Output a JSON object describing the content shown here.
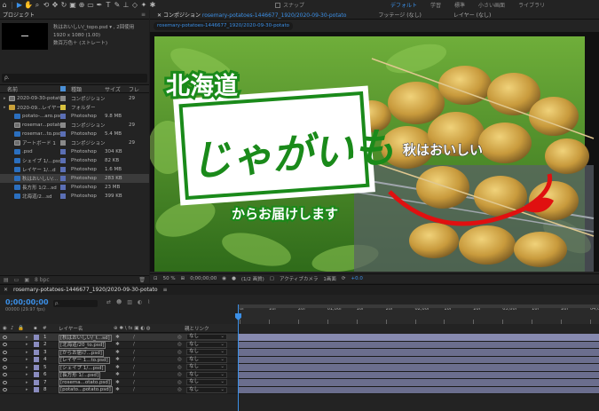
{
  "toolbar": {
    "snap_label": "スナップ",
    "workspaces": [
      "デフォルト",
      "学習",
      "標準",
      "小さい画面",
      "ライブラリ"
    ],
    "tools": [
      "select-icon",
      "hand-icon",
      "zoom-icon",
      "orbit-icon",
      "move-icon",
      "rotate-icon",
      "camera-icon",
      "anchor-icon",
      "rectangle-icon",
      "pen-icon",
      "type-icon",
      "brush-icon",
      "stamp-icon",
      "eraser-icon",
      "roto-icon",
      "puppet-icon"
    ]
  },
  "project": {
    "title": "プロジェクト",
    "selected_name": "秋はおいしい/_topo.psd ▾ , 2回使用",
    "selected_dims": "1920 x 1080 (1.00)",
    "selected_color": "数百万色＋ (ストレート)",
    "search_icon": "ρ.",
    "columns": {
      "name": "名前",
      "type": "種類",
      "size": "サイズ",
      "fr": "フレ"
    },
    "items": [
      {
        "name": "2020-09-30-potato",
        "type": "コンポジション",
        "size": "",
        "fr": "29",
        "icon": "comp",
        "indent": 0,
        "label_color": "#8a8a8a"
      },
      {
        "name": "2020-09...レイヤー",
        "type": "フォルダー",
        "size": "",
        "fr": "",
        "icon": "folder",
        "indent": 0,
        "label_color": "#d8c23e"
      },
      {
        "name": "potato-...aro.psd",
        "type": "Photoshop",
        "size": "9.8 MB",
        "fr": "",
        "icon": "psd",
        "indent": 1,
        "label_color": "#5b6fb5"
      },
      {
        "name": "rosemar...potato",
        "type": "コンポジション",
        "size": "",
        "fr": "29",
        "icon": "comp",
        "indent": 1,
        "label_color": "#8a8a8a"
      },
      {
        "name": "rosemar...to.psd",
        "type": "Photoshop",
        "size": "5.4 MB",
        "fr": "",
        "icon": "psd",
        "indent": 1,
        "label_color": "#5b6fb5"
      },
      {
        "name": "アートボード 1",
        "type": "コンポジション",
        "size": "",
        "fr": "29",
        "icon": "comp",
        "indent": 1,
        "label_color": "#8a8a8a"
      },
      {
        "name": ".psd",
        "type": "Photoshop",
        "size": "304 KB",
        "fr": "",
        "icon": "psd",
        "indent": 1,
        "label_color": "#5b6fb5"
      },
      {
        "name": "シェイプ 1/...psd",
        "type": "Photoshop",
        "size": "82 KB",
        "fr": "",
        "icon": "psd",
        "indent": 1,
        "label_color": "#5b6fb5"
      },
      {
        "name": "レイヤー 1/...d",
        "type": "Photoshop",
        "size": "1.6 MB",
        "fr": "",
        "icon": "psd",
        "indent": 1,
        "label_color": "#5b6fb5"
      },
      {
        "name": "秋はおいしい/...",
        "type": "Photoshop",
        "size": "283 KB",
        "fr": "",
        "icon": "psd",
        "indent": 1,
        "label_color": "#5b6fb5",
        "selected": true
      },
      {
        "name": "長方形 1/2...sd",
        "type": "Photoshop",
        "size": "23 MB",
        "fr": "",
        "icon": "psd",
        "indent": 1,
        "label_color": "#5b6fb5"
      },
      {
        "name": "北海道/2...sd",
        "type": "Photoshop",
        "size": "399 KB",
        "fr": "",
        "icon": "psd",
        "indent": 1,
        "label_color": "#5b6fb5"
      }
    ],
    "footer": "8 bpc"
  },
  "comp": {
    "tabs": [
      {
        "label": "コンポジション",
        "name": "rosemary-potatoes-1446677_1920/2020-09-30-potato",
        "active": true
      },
      {
        "label": "フッテージ",
        "name": "(なし)",
        "active": false
      },
      {
        "label": "レイヤー",
        "name": "(なし)",
        "active": false
      }
    ],
    "breadcrumb": "rosemary-potatoes-1446677_1920/2020-09-30-potato",
    "canvas": {
      "headline": "北海道",
      "main_word": "じゃがいも",
      "sub_text": "からお届けします",
      "tag_text": "秋はおいしい",
      "colors": {
        "green": "#1a8a1a",
        "red": "#e01010",
        "white": "#ffffff"
      }
    },
    "footer": {
      "zoom": "50 %",
      "timecode": "0;00;00;00",
      "resolution": "(1/2 画質)",
      "camera": "アクティブカメラ",
      "views": "1画面",
      "exposure": "+0.0"
    }
  },
  "timeline": {
    "tab": "rosemary-potatoes-1446677_1920/2020-09-30-potato",
    "timecode": "0;00;00;00",
    "frames": "00000 (29.97 fps)",
    "search_placeholder": "ρ.",
    "columns": {
      "name": "レイヤー名",
      "parent": "親とリンク"
    },
    "ruler": [
      "0f",
      "10f",
      "20f",
      "01;00f",
      "10f",
      "20f",
      "02;00f",
      "10f",
      "20f",
      "03;00f",
      "10f",
      "20f",
      "04;00"
    ],
    "layers": [
      {
        "num": "1",
        "name": "[秋はおいしい/_t...sd]",
        "parent": "なし",
        "color": "#8a8cc0",
        "selected": true
      },
      {
        "num": "2",
        "name": "[北海道/20_to.psd]",
        "parent": "なし",
        "color": "#8a8cc0"
      },
      {
        "num": "3",
        "name": "[からお届け...psd]",
        "parent": "なし",
        "color": "#8a8cc0"
      },
      {
        "num": "4",
        "name": "[レイヤー 1...to.psd]",
        "parent": "なし",
        "color": "#8a8cc0"
      },
      {
        "num": "5",
        "name": "[シェイプ 1/...psd]",
        "parent": "なし",
        "color": "#8a8cc0"
      },
      {
        "num": "6",
        "name": "[長方形 1/...psd]",
        "parent": "なし",
        "color": "#8a8cc0"
      },
      {
        "num": "7",
        "name": "[rosema...otato.psd]",
        "parent": "なし",
        "color": "#8a8cc0"
      },
      {
        "num": "8",
        "name": "[potato...potato.psd]",
        "parent": "なし",
        "color": "#8a8cc0"
      }
    ]
  }
}
